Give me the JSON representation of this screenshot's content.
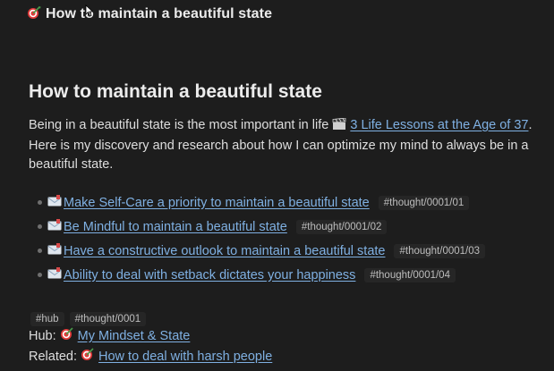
{
  "header": {
    "title": "How to maintain a beautiful state",
    "icon": "dart-icon"
  },
  "page": {
    "heading": "How to maintain a beautiful state",
    "intro_before_link": "Being in a beautiful state is the most important in life ",
    "intro_link": "3 Life Lessons at the Age of 37",
    "intro_after_link": ". Here is my discovery and research about how I can optimize my mind to always be in a beautiful state."
  },
  "bullets": [
    {
      "label": "Make Self-Care a priority to maintain a beautiful state",
      "tag": "#thought/0001/01"
    },
    {
      "label": "Be Mindful to maintain a beautiful state",
      "tag": "#thought/0001/02"
    },
    {
      "label": "Have a constructive outlook to maintain a beautiful state",
      "tag": "#thought/0001/03"
    },
    {
      "label": "Ability to deal with setback dictates your happiness",
      "tag": "#thought/0001/04"
    }
  ],
  "tags": [
    "#hub",
    "#thought/0001"
  ],
  "hub": {
    "label": "Hub:",
    "link": "My Mindset & State"
  },
  "related": {
    "label": "Related:",
    "link": "How to deal with harsh people"
  },
  "colors": {
    "background": "#1d1d1d",
    "text": "#e6e6e6",
    "link": "#7fb0e2",
    "tag": "#bdbdbd"
  }
}
